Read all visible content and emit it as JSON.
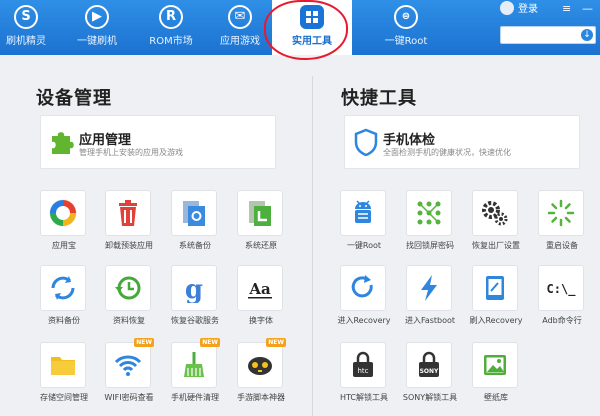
{
  "nav": {
    "tabs": [
      {
        "label": "刷机精灵",
        "icon": "shield-s-icon"
      },
      {
        "label": "一键刷机",
        "icon": "play-icon"
      },
      {
        "label": "ROM市场",
        "icon": "r-logo-icon"
      },
      {
        "label": "应用游戏",
        "icon": "envelope-icon"
      },
      {
        "label": "实用工具",
        "icon": "grid-icon",
        "active": true
      },
      {
        "label": "一键Root",
        "icon": "root-icon"
      }
    ],
    "login_label": "登录",
    "window_controls": [
      "≡",
      "—"
    ]
  },
  "left": {
    "title": "设备管理",
    "banner": {
      "title": "应用管理",
      "subtitle": "管理手机上安装的应用及游戏"
    },
    "tools": [
      {
        "label": "应用宝",
        "icon": "yingyongbao-icon"
      },
      {
        "label": "卸载预装应用",
        "icon": "trash-icon"
      },
      {
        "label": "系统备份",
        "icon": "system-backup-icon"
      },
      {
        "label": "系统还原",
        "icon": "system-restore-icon"
      },
      {
        "label": "资料备份",
        "icon": "sync-icon"
      },
      {
        "label": "资料恢复",
        "icon": "history-icon"
      },
      {
        "label": "恢复谷歌服务",
        "icon": "google-icon"
      },
      {
        "label": "换字体",
        "icon": "font-icon"
      },
      {
        "label": "存储空间管理",
        "icon": "folder-icon"
      },
      {
        "label": "WIFI密码查看",
        "icon": "wifi-icon",
        "new": "NEW"
      },
      {
        "label": "手机硬件清理",
        "icon": "broom-icon",
        "new": "NEW"
      },
      {
        "label": "手游脚本神器",
        "icon": "gamepad-icon",
        "new": "NEW"
      }
    ]
  },
  "right": {
    "title": "快捷工具",
    "banner": {
      "title": "手机体检",
      "subtitle": "全面检测手机的健康状况，快速优化"
    },
    "tools": [
      {
        "label": "一键Root",
        "icon": "android-icon"
      },
      {
        "label": "找回锁屏密码",
        "icon": "pattern-lock-icon"
      },
      {
        "label": "恢复出厂设置",
        "icon": "gears-icon"
      },
      {
        "label": "重启设备",
        "icon": "restart-icon"
      },
      {
        "label": "进入Recovery",
        "icon": "refresh-arrow-icon"
      },
      {
        "label": "进入Fastboot",
        "icon": "lightning-icon"
      },
      {
        "label": "刷入Recovery",
        "icon": "tablet-icon"
      },
      {
        "label": "Adb命令行",
        "icon": "terminal-icon",
        "text": "C:\\_"
      },
      {
        "label": "HTC解锁工具",
        "icon": "htc-lock-icon",
        "text": "htc"
      },
      {
        "label": "SONY解锁工具",
        "icon": "sony-lock-icon",
        "text": "SONY"
      },
      {
        "label": "壁纸库",
        "icon": "wallpaper-icon"
      }
    ]
  },
  "colors": {
    "topbar": "#2383e2",
    "accent": "#1a73d6",
    "highlight_circle": "#e8192e",
    "new_badge": "#f4a21c"
  }
}
